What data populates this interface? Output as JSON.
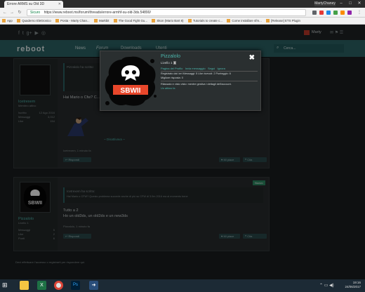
{
  "browser": {
    "tab_title": "Errore ARMS su Old 3D",
    "user_label": "MartyChaney",
    "url_secure": "Sicuro",
    "url": "https://www.reboot.ms/forum/threads/errore-armhf-su-old-3ds.54890/",
    "bookmarks": [
      "App",
      "Quaderno Elettronico",
      "Posta - Marty Chan...",
      "Markbit",
      "The Good Fight Gu...",
      "Skon (Mario Bart 8)",
      "Tutorials to create c...",
      "Come installare sfm...",
      "[Release] ETS Plugin"
    ]
  },
  "site": {
    "logo": "reboot",
    "nav": [
      "News",
      "Forum",
      "Downloads",
      "Utenti"
    ],
    "search_placeholder": "Cerca...",
    "account": "Marty"
  },
  "popup": {
    "username": "Pizzalolo",
    "level": "Livello 1",
    "badge": "5",
    "links": [
      "Pagina del Profilo",
      "Invia messaggio",
      "Segui",
      "Ignora"
    ],
    "stats_line": "Registrato dal: ieri   Messaggi: 5   Like ricevuti: 2   Punteggio: 6",
    "stats_line2": "Migliore risposta: 0",
    "status_line": "Rilassato e visto visto: mentre gestiva i dettagli dell'account.",
    "status_link": "Un attimo fa",
    "avatar_text": "SBWII",
    "close": "✖"
  },
  "post1": {
    "author": "Icetrexem",
    "title": "Membro attivo",
    "meta": [
      [
        "Iscritto",
        "12 Ago 2016"
      ],
      [
        "Messaggi",
        "3,012"
      ],
      [
        "Like",
        "154"
      ]
    ],
    "quote_header": "Pizzalolo ha scritto:",
    "question": "Hai Mario o Cfw? C...",
    "attachment": "~ Disattivava ~",
    "footer": "Icetrexem, 1 minuto fa"
  },
  "post2": {
    "author": "Pizzalolo",
    "title": "Livello 1",
    "quote_header": "Icetrexem ha scritto:",
    "quote_body": "Hai Mario o CFW? Questo problema succede anche di più su CFW di 3.0m 2016 ma al momento bene",
    "body1": "Tutto a 2",
    "body2": "Ho un old3ds, un old2ds e un new3ds",
    "footer": "Pizzalolo, 1 minuto fa",
    "new_badge": "Nuovo",
    "meta": [
      [
        "Messaggi",
        "5"
      ],
      [
        "Like",
        "2"
      ],
      [
        "Punti",
        "6"
      ]
    ]
  },
  "footer_note": "Devi effettuare l'accesso o registrarti per rispondere qui.",
  "taskbar": {
    "time": "19:16",
    "date": "24/06/2017"
  },
  "colors": {
    "accent": "#2d6567",
    "link": "#4db6ac",
    "page_bg": "#1a1e1f"
  }
}
